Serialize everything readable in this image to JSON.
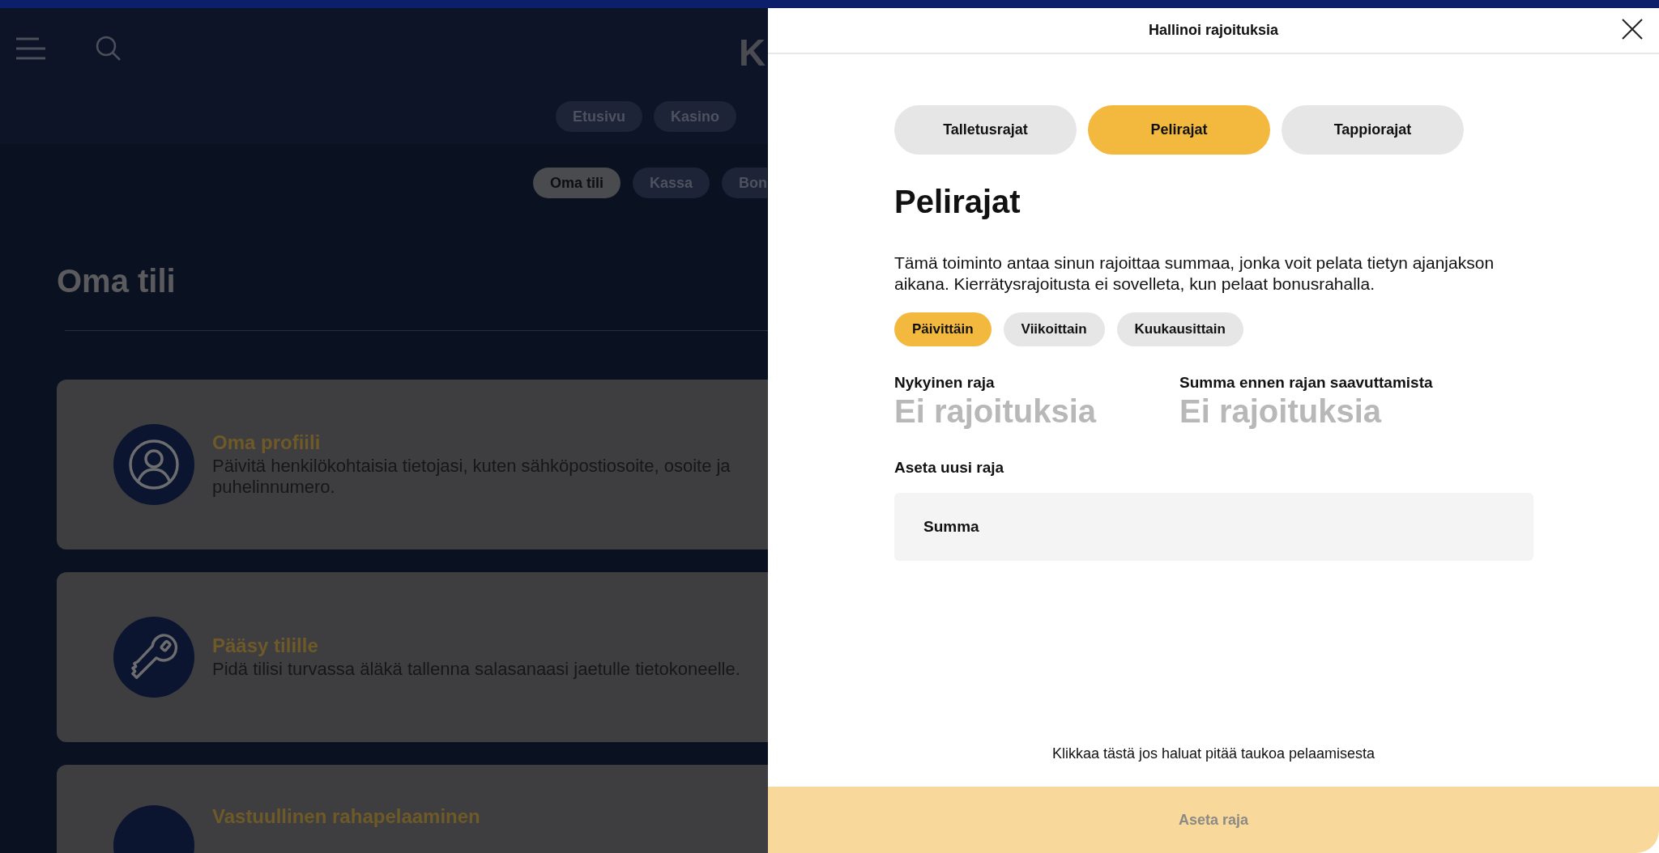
{
  "background_page": {
    "logo_fragment": "K",
    "nav": [
      {
        "label": "Etusivu",
        "selected": false
      },
      {
        "label": "Kasino",
        "selected": false
      }
    ],
    "subnav": [
      {
        "label": "Oma tili",
        "selected": true
      },
      {
        "label": "Kassa",
        "selected": false
      },
      {
        "label": "Bon",
        "selected": false
      }
    ],
    "heading": "Oma tili",
    "cards": [
      {
        "kind": "person",
        "title": "Oma profiili",
        "description": "Päivitä henkilökohtaisia tietojasi, kuten sähköpostiosoite, osoite ja puhelinnumero."
      },
      {
        "kind": "key",
        "title": "Pääsy tilille",
        "description": "Pidä tilisi turvassa äläkä tallenna salasanaasi jaetulle tietokoneelle."
      },
      {
        "kind": "blank",
        "title": "Vastuullinen rahapelaaminen"
      }
    ]
  },
  "dialog": {
    "title": "Hallinoi rajoituksia",
    "tabs": [
      {
        "label": "Talletusrajat",
        "selected": false
      },
      {
        "label": "Pelirajat",
        "selected": true
      },
      {
        "label": "Tappiorajat",
        "selected": false
      }
    ],
    "heading": "Pelirajat",
    "description": "Tämä toiminto antaa sinun rajoittaa summaa, jonka voit pelata tietyn ajanjakson aikana. Kierrätysrajoitusta ei sovelleta, kun pelaat bonusrahalla.",
    "periods": [
      {
        "label": "Päivittäin",
        "selected": true
      },
      {
        "label": "Viikoittain",
        "selected": false
      },
      {
        "label": "Kuukausittain",
        "selected": false
      }
    ],
    "stats": [
      {
        "label": "Nykyinen raja",
        "value": "Ei rajoituksia"
      },
      {
        "label": "Summa ennen rajan saavuttamista",
        "value": "Ei rajoituksia"
      }
    ],
    "new_limit_label": "Aseta uusi raja",
    "amount_field": {
      "placeholder": "Summa"
    },
    "pause_link": "Klikkaa tästä jos haluat pitää taukoa pelaamisesta",
    "submit_button": {
      "label": "Aseta raja",
      "disabled": true
    }
  }
}
